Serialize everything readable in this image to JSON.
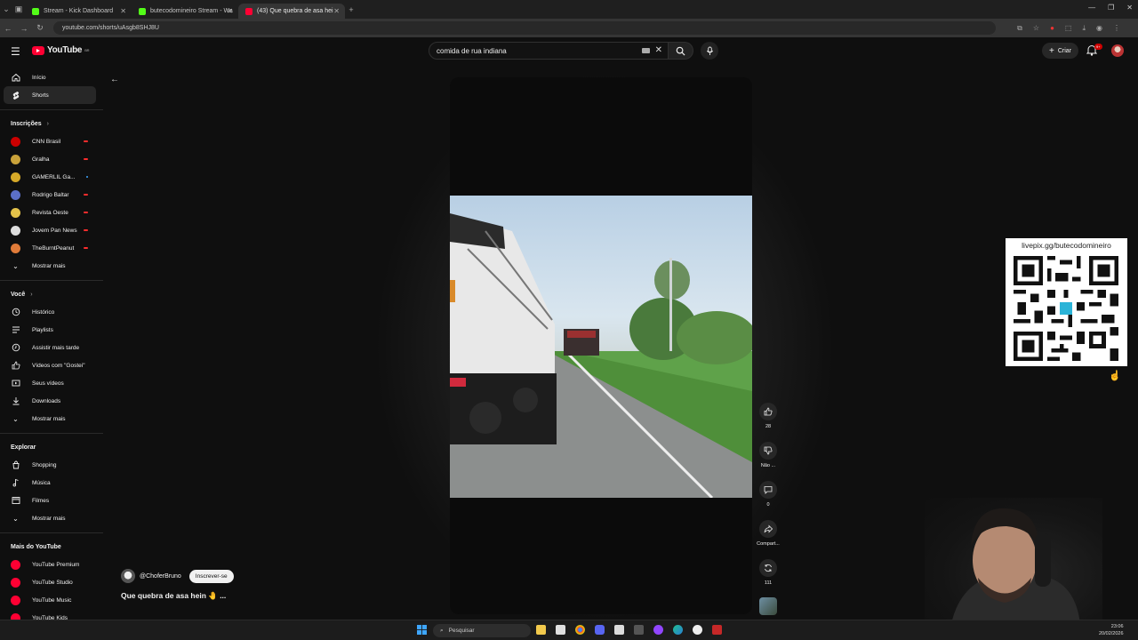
{
  "browser": {
    "tabs": [
      {
        "label": "Stream - Kick Dashboard",
        "color": "#53fc18",
        "active": false
      },
      {
        "label": "butecodomineiro Stream - Wa",
        "color": "#53fc18",
        "active": false
      },
      {
        "label": "(43) Que quebra de asa hei",
        "color": "#ff0033",
        "active": true
      }
    ],
    "url": "youtube.com/shorts/uAsgb8SHJ8U"
  },
  "header": {
    "logo_text": "YouTube",
    "logo_sup": "BR",
    "search_value": "comida de rua indiana",
    "create_label": "Criar",
    "notif_count": "9+"
  },
  "sidebar": {
    "main": [
      {
        "label": "Início",
        "icon": "home-icon"
      },
      {
        "label": "Shorts",
        "icon": "shorts-icon",
        "active": true
      }
    ],
    "subs_heading": "Inscrições",
    "subscriptions": [
      {
        "label": "CNN Brasil",
        "color": "#cc0000",
        "live": true
      },
      {
        "label": "Gralha",
        "color": "#c9a23a",
        "live": true
      },
      {
        "label": "GAMERLIL Ga...",
        "color": "#d6a928",
        "dot": true
      },
      {
        "label": "Rodrigo Baltar",
        "color": "#5b6fc7",
        "live": true
      },
      {
        "label": "Revista Oeste",
        "color": "#e3c24a",
        "live": true
      },
      {
        "label": "Jovem Pan News",
        "color": "#dddddd",
        "live": true
      },
      {
        "label": "TheBurntPeanut",
        "color": "#e07b39",
        "live": true
      }
    ],
    "subs_more": "Mostrar mais",
    "you_heading": "Você",
    "you_items": [
      {
        "label": "Histórico",
        "icon": "history-icon"
      },
      {
        "label": "Playlists",
        "icon": "playlist-icon"
      },
      {
        "label": "Assistir mais tarde",
        "icon": "watch-later-icon"
      },
      {
        "label": "Vídeos com \"Gostei\"",
        "icon": "like-icon"
      },
      {
        "label": "Seus vídeos",
        "icon": "your-videos-icon"
      },
      {
        "label": "Downloads",
        "icon": "download-icon"
      }
    ],
    "you_more": "Mostrar mais",
    "explore_heading": "Explorar",
    "explore_items": [
      {
        "label": "Shopping",
        "icon": "shopping-icon"
      },
      {
        "label": "Música",
        "icon": "music-icon"
      },
      {
        "label": "Filmes",
        "icon": "film-icon"
      }
    ],
    "explore_more": "Mostrar mais",
    "more_heading": "Mais do YouTube",
    "more_items": [
      {
        "label": "YouTube Premium"
      },
      {
        "label": "YouTube Studio"
      },
      {
        "label": "YouTube Music"
      },
      {
        "label": "YouTube Kids"
      }
    ]
  },
  "short": {
    "channel": "@ChoferBruno",
    "subscribe_label": "Inscrever-se",
    "title": "Que quebra de asa hein 🤚 ...",
    "likes": "28",
    "dislike_label": "Não ...",
    "comments": "0",
    "share_label": "Compart...",
    "remix_count": "111"
  },
  "overlay": {
    "qr_label": "livepix.gg/butecodomineiro"
  },
  "taskbar": {
    "search_placeholder": "Pesquisar",
    "time": "23:06",
    "date": "20/02/2026"
  }
}
